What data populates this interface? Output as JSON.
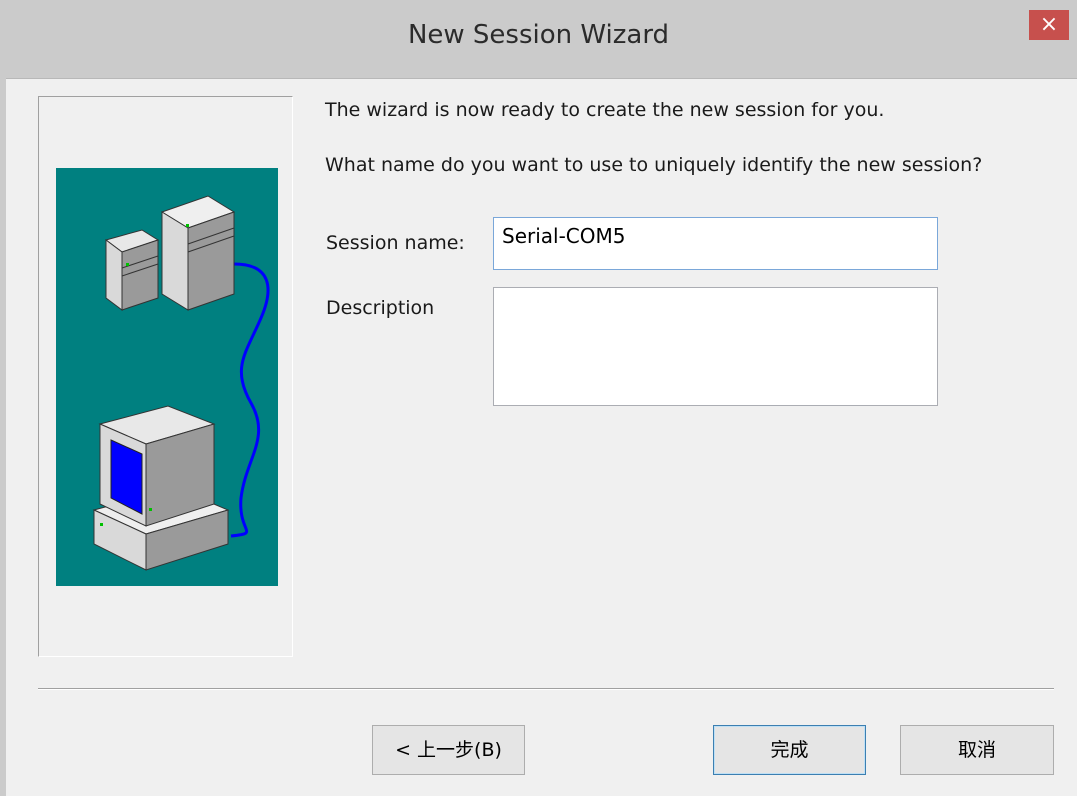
{
  "window": {
    "title": "New Session Wizard",
    "close_glyph": "×"
  },
  "wizard": {
    "intro": "The wizard is now ready to create the new session for you.",
    "question": "What name do you want to use to uniquely identify the new session?",
    "session_name_label": "Session name:",
    "session_name_value": "Serial-COM5",
    "description_label": "Description",
    "description_value": ""
  },
  "buttons": {
    "back": "< 上一步(B)",
    "finish": "完成",
    "cancel": "取消"
  },
  "colors": {
    "illustration_bg": "#008080",
    "cable": "#0000ff",
    "screen": "#0000ff",
    "close": "#c7504d"
  }
}
